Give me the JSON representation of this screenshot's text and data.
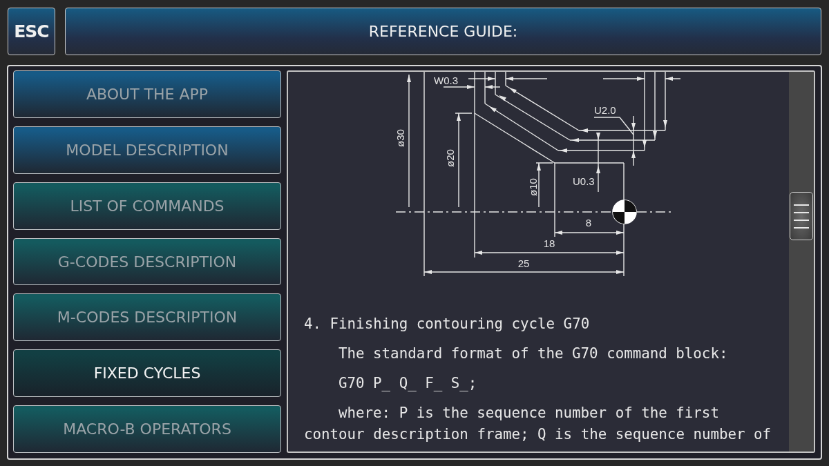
{
  "header": {
    "esc_button": "ESC",
    "title": "REFERENCE GUIDE:"
  },
  "sidebar": {
    "items": [
      {
        "label": "ABOUT THE APP",
        "color": "#175a86",
        "selected": false
      },
      {
        "label": "MODEL DESCRIPTION",
        "color": "#175a86",
        "selected": false
      },
      {
        "label": "LIST OF COMMANDS",
        "color": "#145a5e",
        "selected": false
      },
      {
        "label": "G-CODES DESCRIPTION",
        "color": "#145a5e",
        "selected": false
      },
      {
        "label": "M-CODES DESCRIPTION",
        "color": "#145a5e",
        "selected": false
      },
      {
        "label": "FIXED CYCLES",
        "color": "#123f43",
        "selected": true
      },
      {
        "label": "MACRO-B OPERATORS",
        "color": "#145a5e",
        "selected": false
      }
    ]
  },
  "content": {
    "diagram": {
      "labels": [
        "W0.3",
        "U2.0",
        "ø30",
        "ø20",
        "ø10",
        "U0.3",
        "8",
        "18",
        "25"
      ]
    },
    "heading": "4. Finishing contouring cycle G70",
    "paragraphs": [
      "The standard format of the G70 command block:",
      "G70 P_ Q_ F_ S_;",
      "where: P is the sequence number of the first contour description frame; Q is the sequence number of"
    ]
  }
}
